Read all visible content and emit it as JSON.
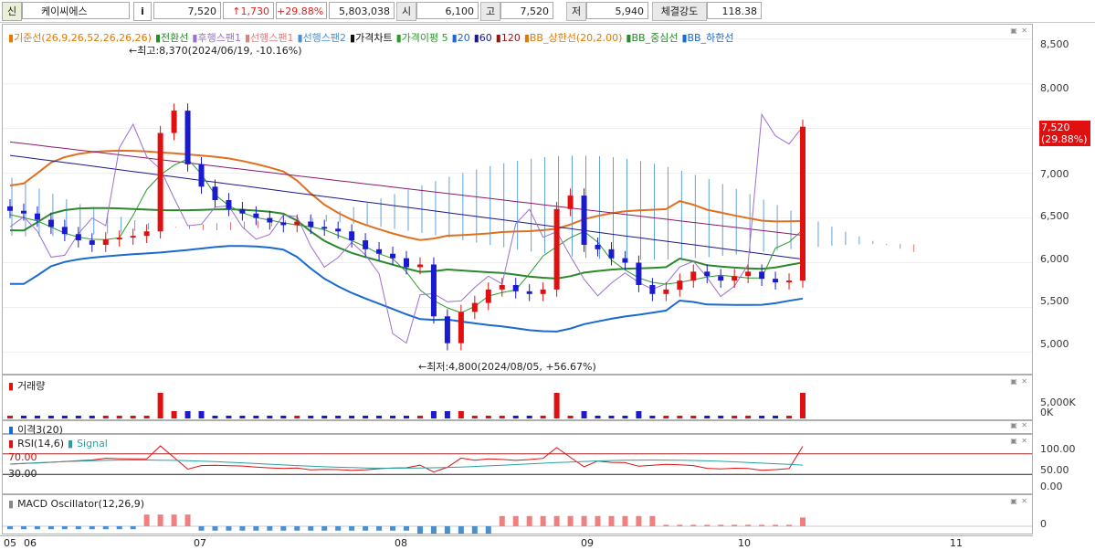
{
  "topbar": {
    "market_badge": "신",
    "stock_name": "케이씨에스",
    "info_button": "i",
    "price": "7,520",
    "change": "↑1,730",
    "change_rate": "+29.88%",
    "volume": "5,803,038",
    "open_label": "시",
    "open": "6,100",
    "high_label": "고",
    "high": "7,520",
    "low_label": "저",
    "low": "5,940",
    "strength_label": "체결강도",
    "strength": "118.38"
  },
  "price_panel": {
    "legend": [
      {
        "text": "기준선(26,9,26,52,26,26,26)",
        "color": "#e07b00"
      },
      {
        "text": "전환선",
        "color": "#2a8a2a"
      },
      {
        "text": "후행스팬1",
        "color": "#9b6fd0"
      },
      {
        "text": "선행스팬1",
        "color": "#e08080"
      },
      {
        "text": "선행스팬2",
        "color": "#4a90d0"
      },
      {
        "text": "가격차트",
        "color": "#111111"
      },
      {
        "text": "가격이평 5",
        "color": "#2a9a2a"
      },
      {
        "text": "20",
        "color": "#1a6ad0"
      },
      {
        "text": "60",
        "color": "#1a1a8a"
      },
      {
        "text": "120",
        "color": "#8a1a1a"
      },
      {
        "text": "BB_상한선(20,2.00)",
        "color": "#e07b00"
      },
      {
        "text": "BB_중심선",
        "color": "#2a8a2a"
      },
      {
        "text": "BB_하한선",
        "color": "#1a6ad0"
      }
    ],
    "high_annotation": "←최고:8,370(2024/06/19, -10.16%)",
    "low_annotation": "←최저:4,800(2024/08/05, +56.67%)",
    "y_ticks": [
      "8,500",
      "8,000",
      "7,500",
      "7,000",
      "6,500",
      "6,000",
      "5,500",
      "5,000"
    ],
    "current_price_tag": "7,520",
    "current_rate_tag": "(29.88%)"
  },
  "volume_panel": {
    "legend": "거래량",
    "y_ticks": [
      "5,000K",
      "0K"
    ]
  },
  "disparity_panel": {
    "legend": "이격3(20)"
  },
  "rsi_panel": {
    "legend_rsi": "RSI(14,6)",
    "legend_signal": "Signal",
    "level_high": "70.00",
    "level_low": "30.00",
    "y_ticks": [
      "100.00",
      "50.00",
      "0.00"
    ]
  },
  "macd_panel": {
    "legend": "MACD Oscillator(12,26,9)",
    "y_ticks": [
      "0"
    ]
  },
  "x_axis": {
    "labels": [
      "05",
      "06",
      "07",
      "08",
      "09",
      "10",
      "11"
    ]
  },
  "chart_data": {
    "type": "candlestick",
    "series_close_approx": [
      6580,
      6550,
      6480,
      6400,
      6320,
      6250,
      6200,
      6260,
      6280,
      6300,
      6350,
      7450,
      7700,
      7100,
      6850,
      6700,
      6600,
      6550,
      6500,
      6450,
      6420,
      6460,
      6400,
      6380,
      6350,
      6250,
      6150,
      6100,
      6050,
      5950,
      5980,
      5400,
      5100,
      5450,
      5550,
      5700,
      5750,
      5680,
      5650,
      5700,
      6600,
      6750,
      6200,
      6150,
      6050,
      6000,
      5750,
      5650,
      5700,
      5800,
      5900,
      5850,
      5800,
      5850,
      5900,
      5820,
      5780,
      5800,
      7520
    ],
    "ylim": [
      4800,
      8600
    ],
    "high": 8370,
    "low": 4800,
    "last": 7520
  }
}
